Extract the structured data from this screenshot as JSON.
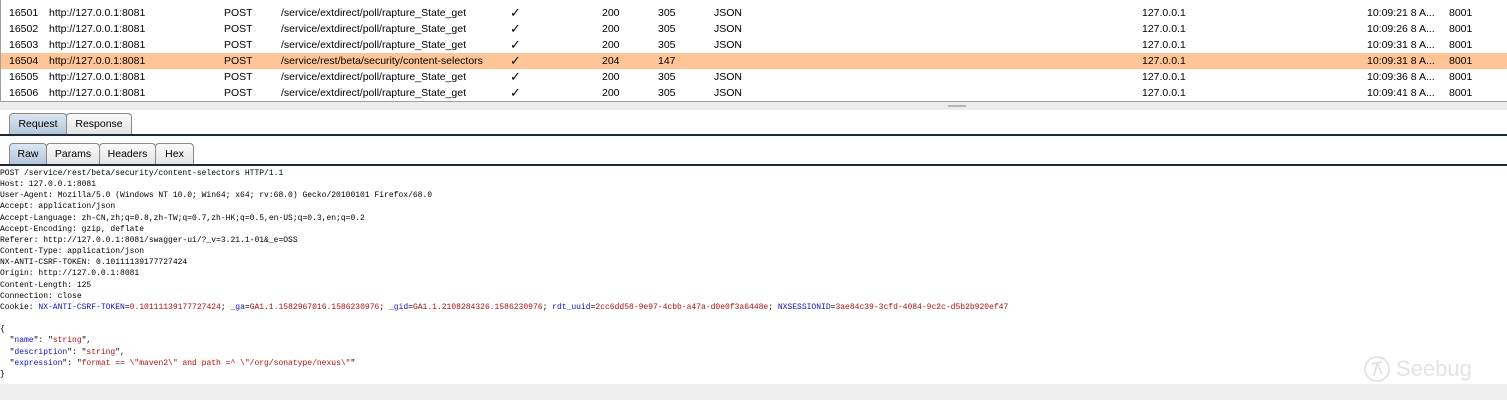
{
  "history": {
    "rows": [
      {
        "id": "16501",
        "host": "http://127.0.0.1:8081",
        "method": "POST",
        "url": "/service/extdirect/poll/rapture_State_get",
        "params": "✓",
        "status": "200",
        "length": "305",
        "mime": "JSON",
        "ip": "127.0.0.1",
        "time": "10:09:21 8 A...",
        "port": "8001",
        "selected": false
      },
      {
        "id": "16502",
        "host": "http://127.0.0.1:8081",
        "method": "POST",
        "url": "/service/extdirect/poll/rapture_State_get",
        "params": "✓",
        "status": "200",
        "length": "305",
        "mime": "JSON",
        "ip": "127.0.0.1",
        "time": "10:09:26 8 A...",
        "port": "8001",
        "selected": false
      },
      {
        "id": "16503",
        "host": "http://127.0.0.1:8081",
        "method": "POST",
        "url": "/service/extdirect/poll/rapture_State_get",
        "params": "✓",
        "status": "200",
        "length": "305",
        "mime": "JSON",
        "ip": "127.0.0.1",
        "time": "10:09:31 8 A...",
        "port": "8001",
        "selected": false
      },
      {
        "id": "16504",
        "host": "http://127.0.0.1:8081",
        "method": "POST",
        "url": "/service/rest/beta/security/content-selectors",
        "params": "✓",
        "status": "204",
        "length": "147",
        "mime": "",
        "ip": "127.0.0.1",
        "time": "10:09:31 8 A...",
        "port": "8001",
        "selected": true
      },
      {
        "id": "16505",
        "host": "http://127.0.0.1:8081",
        "method": "POST",
        "url": "/service/extdirect/poll/rapture_State_get",
        "params": "✓",
        "status": "200",
        "length": "305",
        "mime": "JSON",
        "ip": "127.0.0.1",
        "time": "10:09:36 8 A...",
        "port": "8001",
        "selected": false
      },
      {
        "id": "16506",
        "host": "http://127.0.0.1:8081",
        "method": "POST",
        "url": "/service/extdirect/poll/rapture_State_get",
        "params": "✓",
        "status": "200",
        "length": "305",
        "mime": "JSON",
        "ip": "127.0.0.1",
        "time": "10:09:41 8 A...",
        "port": "8001",
        "selected": false
      }
    ]
  },
  "tabs": [
    "Request",
    "Response"
  ],
  "subtabs": [
    "Raw",
    "Params",
    "Headers",
    "Hex"
  ],
  "request": {
    "headers": [
      "POST /service/rest/beta/security/content-selectors HTTP/1.1",
      "Host: 127.0.0.1:8081",
      "User-Agent: Mozilla/5.0 (Windows NT 10.0; Win64; x64; rv:68.0) Gecko/20100101 Firefox/68.0",
      "Accept: application/json",
      "Accept-Language: zh-CN,zh;q=0.8,zh-TW;q=0.7,zh-HK;q=0.5,en-US;q=0.3,en;q=0.2",
      "Accept-Encoding: gzip, deflate",
      "Referer: http://127.0.0.1:8081/swagger-ui/?_v=3.21.1-01&_e=OSS",
      "Content-Type: application/json",
      "NX-ANTI-CSRF-TOKEN: 0.10111139177727424",
      "Origin: http://127.0.0.1:8081",
      "Content-Length: 125",
      "Connection: close"
    ],
    "cookie_label": "Cookie: ",
    "cookies": [
      {
        "k": "NX-ANTI-CSRF-TOKEN",
        "v": "0.10111139177727424"
      },
      {
        "k": "_ga",
        "v": "GA1.1.1582967016.1586230976"
      },
      {
        "k": "_gid",
        "v": "GA1.1.2108284326.1586230976"
      },
      {
        "k": "rdt_uuid",
        "v": "2cc6dd58-9e97-4cbb-a47a-d0e0f3a6448e"
      },
      {
        "k": "NXSESSIONID",
        "v": "3ae84c39-3cfd-4084-9c2c-d5b2b920ef47"
      }
    ],
    "body": [
      {
        "k": "name",
        "v": "string"
      },
      {
        "k": "description",
        "v": "string"
      },
      {
        "k": "expression",
        "v": "format == \\\"maven2\\\" and path =^ \\\"/org/sonatype/nexus\\\""
      }
    ]
  },
  "watermark": "Seebug",
  "colors": {
    "selected_row": "#ffc597",
    "key": "#1010c8",
    "value": "#b01010"
  }
}
